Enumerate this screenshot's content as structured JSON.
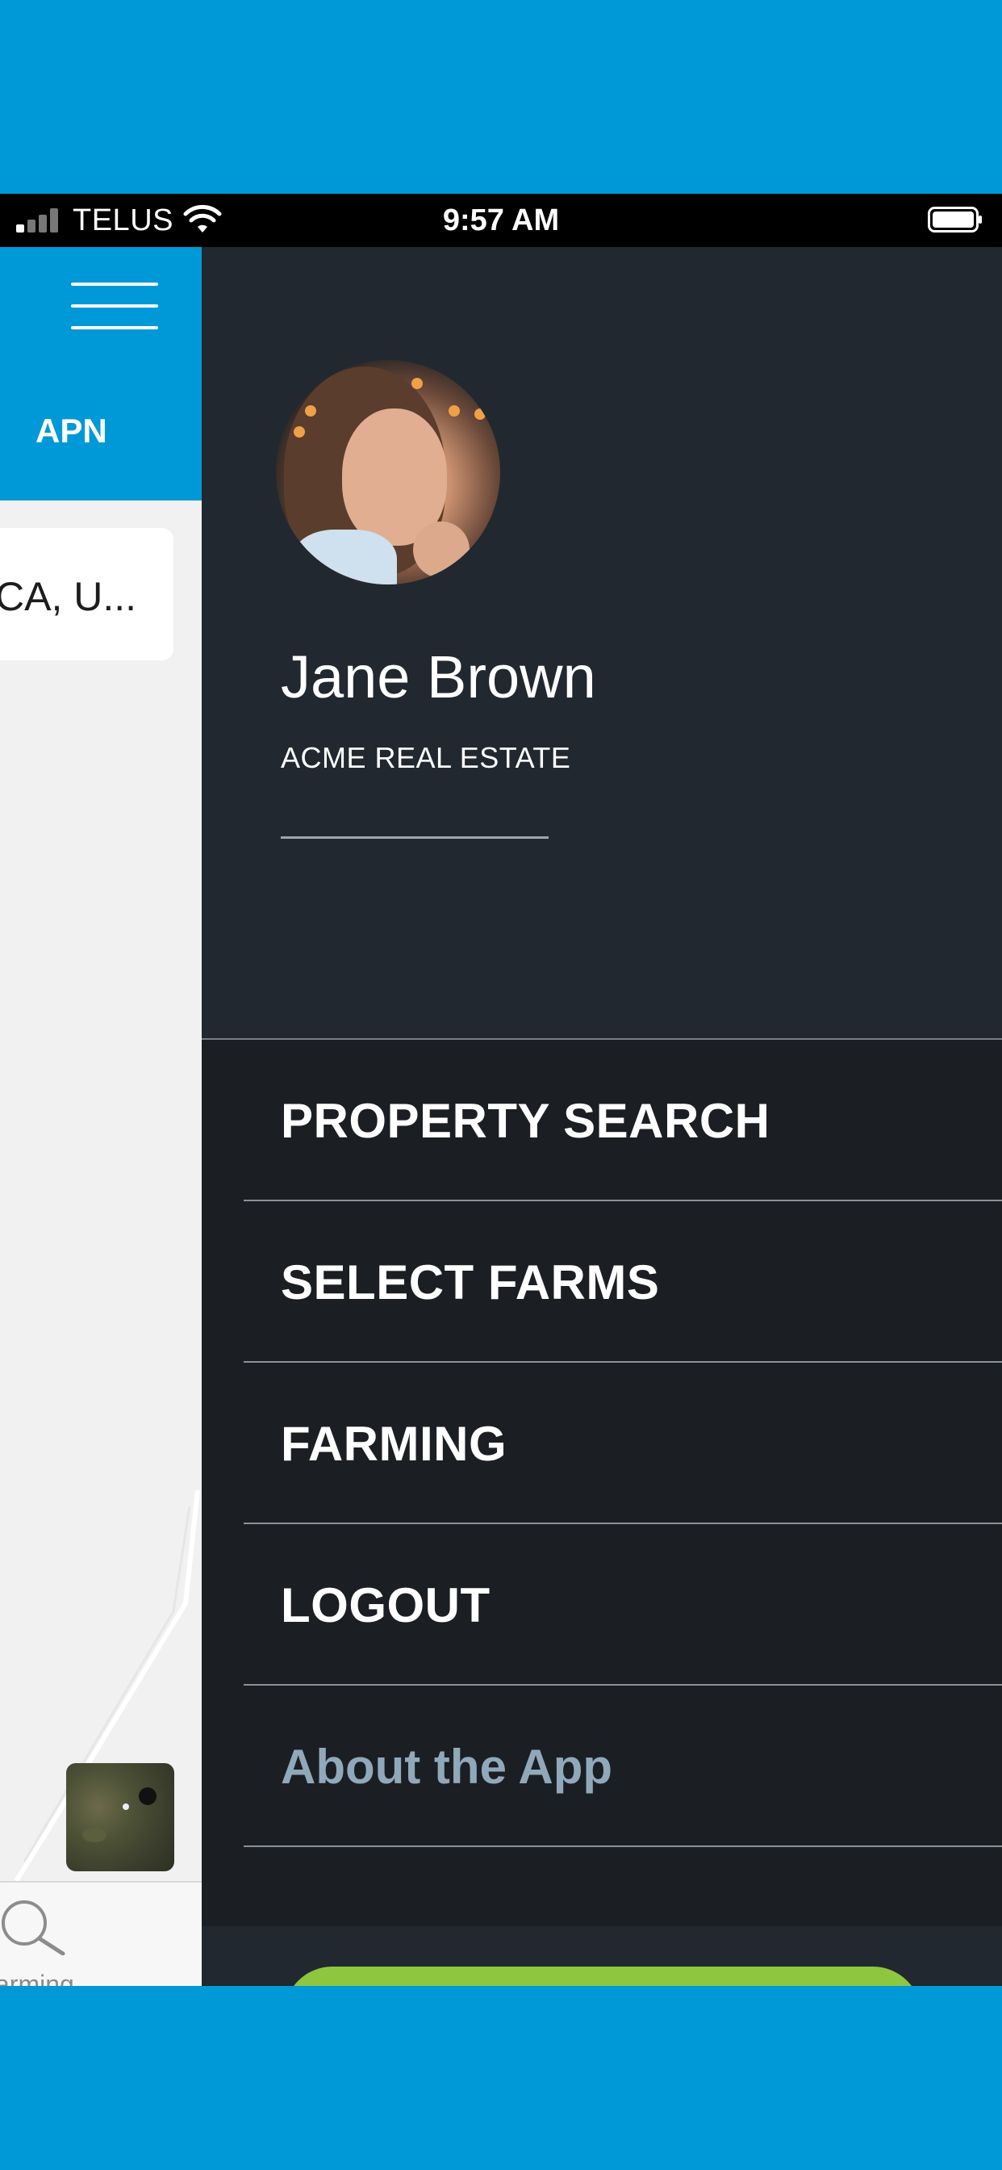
{
  "colors": {
    "background": "#0099D8",
    "header_blue": "#0099D8",
    "drawer_dark": "#1B1F23",
    "profile_dark": "#22282F",
    "about_link": "#90A9BA",
    "green_button": "#8DC63F"
  },
  "status_bar": {
    "carrier": "TELUS",
    "time": "9:57 AM",
    "icons": [
      "signal-icon",
      "wifi-icon",
      "battery-icon"
    ]
  },
  "background_screen": {
    "header_tab": "APN",
    "address_preview": "CA, U...",
    "bottom_tab_label": "arming",
    "icons": [
      "hamburger-menu-icon",
      "search-icon",
      "map-thumbnail"
    ]
  },
  "drawer": {
    "user_name": "Jane Brown",
    "company": "ACME REAL ESTATE",
    "menu": [
      {
        "label": "PROPERTY SEARCH"
      },
      {
        "label": "SELECT FARMS"
      },
      {
        "label": "FARMING"
      },
      {
        "label": "LOGOUT"
      },
      {
        "label": "About the App"
      }
    ]
  }
}
